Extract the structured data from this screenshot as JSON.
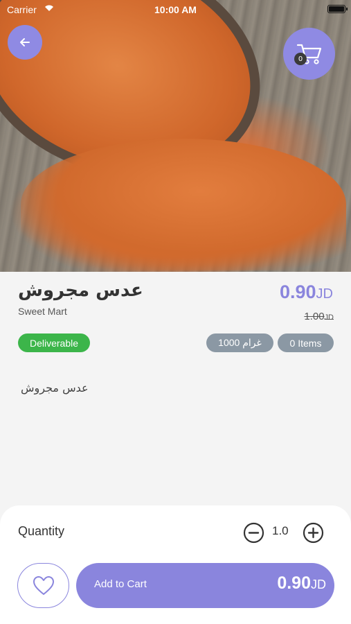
{
  "status_bar": {
    "carrier": "Carrier",
    "time": "10:00 AM"
  },
  "header": {
    "back_icon": "arrow-left-icon",
    "cart_icon": "cart-icon",
    "cart_count": "0"
  },
  "product": {
    "name": "عدس مجروش",
    "store": "Sweet Mart",
    "price": "0.90",
    "currency": "JD",
    "old_price": "1.00",
    "old_currency": "JD",
    "deliverable_label": "Deliverable",
    "weight_label": "غرام 1000",
    "items_label": "0 Items",
    "description": "عدس مجروش"
  },
  "bottom": {
    "quantity_label": "Quantity",
    "quantity_value": "1.0",
    "add_to_cart_label": "Add to Cart",
    "total_price": "0.90",
    "total_currency": "JD"
  },
  "colors": {
    "accent": "#8a85dd",
    "green": "#3cb54a",
    "gray_badge": "#8b98a4"
  }
}
